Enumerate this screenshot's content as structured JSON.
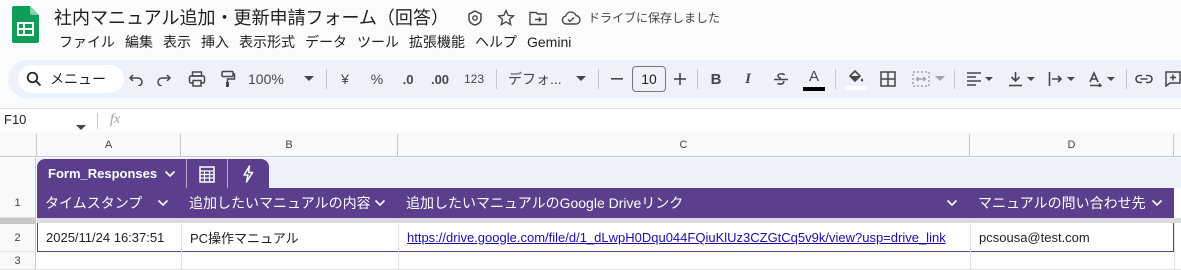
{
  "app": {
    "title": "社内マニュアル追加・更新申請フォーム（回答）",
    "saved_status": "ドライブに保存しました"
  },
  "menu": [
    "ファイル",
    "編集",
    "表示",
    "挿入",
    "表示形式",
    "データ",
    "ツール",
    "拡張機能",
    "ヘルプ",
    "Gemini"
  ],
  "toolbar": {
    "search_label": "メニュー",
    "zoom": "100%",
    "currency": "¥",
    "percent": "%",
    "decimal_decrease": ".0",
    "decimal_increase": ".00",
    "number_format": "123",
    "font_family": "デフォ...",
    "font_size": "10",
    "bold": "B",
    "italic": "I",
    "text_color_label": "A",
    "text_color": "#000000"
  },
  "formula_bar": {
    "cell_ref": "F10",
    "fx_label": "fx",
    "value": ""
  },
  "columns": [
    "A",
    "B",
    "C",
    "D"
  ],
  "rows": [
    "1",
    "2",
    "3"
  ],
  "table": {
    "name": "Form_Responses",
    "accent": "#5b3f8c",
    "headers": [
      "タイムスタンプ",
      "追加したいマニュアルの内容",
      "追加したいマニュアルのGoogle Driveリンク",
      "マニュアルの問い合わせ先"
    ],
    "rows": [
      [
        "2025/11/24 16:37:51",
        "PC操作マニュアル",
        "https://drive.google.com/file/d/1_dLwpH0Dqu044FQiuKlUz3CZGtCq5v9k/view?usp=drive_link",
        "pcsousa@test.com"
      ]
    ]
  }
}
